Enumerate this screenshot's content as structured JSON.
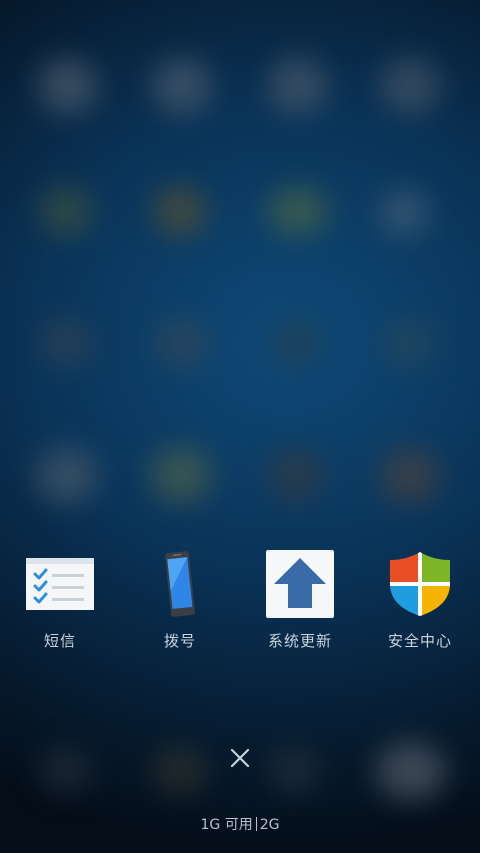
{
  "recent_apps": [
    {
      "label": "短信",
      "icon": "sms-checklist-icon"
    },
    {
      "label": "拨号",
      "icon": "phone-icon"
    },
    {
      "label": "系统更新",
      "icon": "system-update-arrow-icon"
    },
    {
      "label": "安全中心",
      "icon": "security-shield-icon"
    }
  ],
  "close_icon": "close-icon",
  "memory": {
    "available": "1G 可用",
    "total": "2G"
  },
  "colors": {
    "background": "#0a3358",
    "label_text": "#c9d4de",
    "update_arrow": "#3a6aa8",
    "shield_red": "#e94f24",
    "shield_green": "#7cb526",
    "shield_blue": "#1e9ee0",
    "shield_yellow": "#f5b400"
  }
}
